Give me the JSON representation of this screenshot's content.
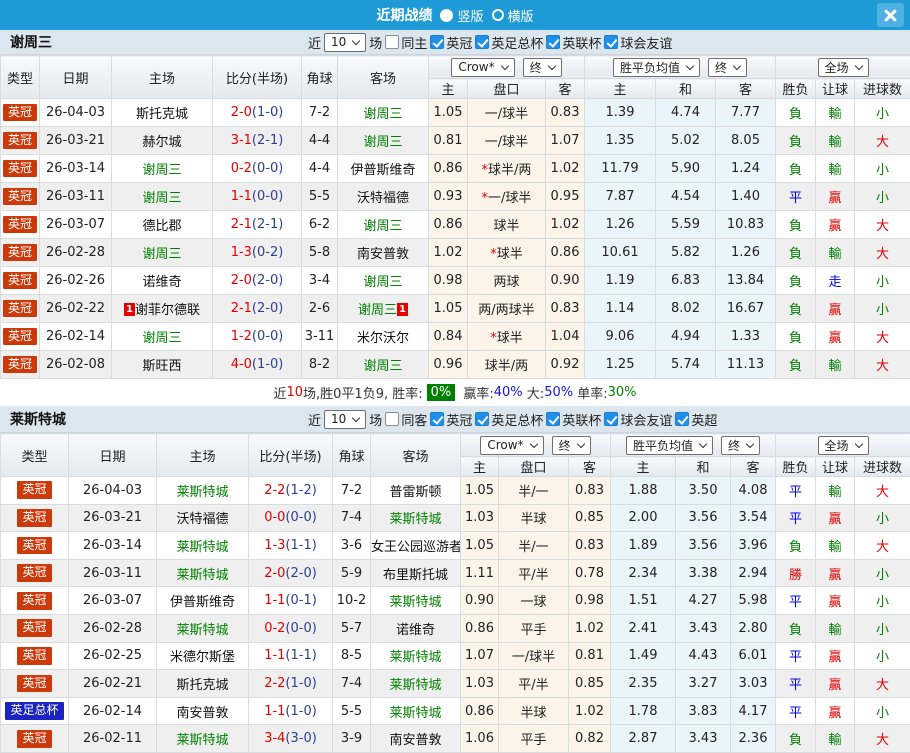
{
  "titlebar": {
    "title": "近期战绩",
    "layout_options": [
      {
        "label": "竖版",
        "selected": true
      },
      {
        "label": "横版",
        "selected": false
      }
    ]
  },
  "colors": {
    "titlebar": "#1e9ad7",
    "league_badge_red": "#cc3a0c",
    "facup_badge_blue": "#1b24c0",
    "win_red": "#e60000",
    "draw_blue": "#0000e0",
    "loss_green": "#008000",
    "self_team_green": "#008000"
  },
  "table_header": {
    "cols": {
      "type": "类型",
      "date": "日期",
      "home": "主场",
      "score": "比分(半场)",
      "corner": "角球",
      "away": "客场",
      "odds_home": "主",
      "handicap": "盘口",
      "odds_away": "客",
      "avg_home": "主",
      "avg_draw": "和",
      "avg_away": "客",
      "result": "胜负",
      "handicap_result": "让球",
      "goals": "进球数"
    },
    "selects": {
      "company": "Crow*",
      "company_time": "终",
      "avg": "胜平负均值",
      "avg_time": "终",
      "scope": "全场"
    }
  },
  "teams": [
    {
      "name": "谢周三",
      "filters": {
        "near_label": "近",
        "games_value": "10",
        "games_label": "场",
        "same_label": "同主",
        "same_checked": false,
        "leagues": [
          {
            "label": "英冠",
            "checked": true
          },
          {
            "label": "英足总杯",
            "checked": true
          },
          {
            "label": "英联杯",
            "checked": true
          },
          {
            "label": "球会友谊",
            "checked": true
          }
        ]
      },
      "rows": [
        {
          "league": "英冠",
          "date": "26-04-03",
          "home": "斯托克城",
          "score": "2-0",
          "half": "(1-0)",
          "corner": "7-2",
          "away": "谢周三",
          "odds": [
            "1.05",
            "一/球半",
            "0.83"
          ],
          "avg": [
            "1.39",
            "4.74",
            "7.77"
          ],
          "res": "負",
          "lb": "輸",
          "goal": "小"
        },
        {
          "league": "英冠",
          "date": "26-03-21",
          "home": "赫尔城",
          "score": "3-1",
          "half": "(2-1)",
          "corner": "4-4",
          "away": "谢周三",
          "odds": [
            "0.81",
            "一/球半",
            "1.07"
          ],
          "avg": [
            "1.35",
            "5.02",
            "8.05"
          ],
          "res": "負",
          "lb": "輸",
          "goal": "大"
        },
        {
          "league": "英冠",
          "date": "26-03-14",
          "home": "谢周三",
          "score": "0-2",
          "half": "(0-0)",
          "corner": "4-4",
          "away": "伊普斯维奇",
          "odds": [
            "0.86",
            "*球半/两",
            "1.02"
          ],
          "avg": [
            "11.79",
            "5.90",
            "1.24"
          ],
          "res": "負",
          "lb": "輸",
          "goal": "小"
        },
        {
          "league": "英冠",
          "date": "26-03-11",
          "home": "谢周三",
          "score": "1-1",
          "half": "(0-0)",
          "corner": "5-5",
          "away": "沃特福德",
          "odds": [
            "0.93",
            "*一/球半",
            "0.95"
          ],
          "avg": [
            "7.87",
            "4.54",
            "1.40"
          ],
          "res": "平",
          "lb": "贏",
          "goal": "小"
        },
        {
          "league": "英冠",
          "date": "26-03-07",
          "home": "德比郡",
          "score": "2-1",
          "half": "(2-1)",
          "corner": "6-2",
          "away": "谢周三",
          "odds": [
            "0.86",
            "球半",
            "1.02"
          ],
          "avg": [
            "1.26",
            "5.59",
            "10.83"
          ],
          "res": "負",
          "lb": "贏",
          "goal": "大"
        },
        {
          "league": "英冠",
          "date": "26-02-28",
          "home": "谢周三",
          "score": "1-3",
          "half": "(0-2)",
          "corner": "5-8",
          "away": "南安普敦",
          "odds": [
            "1.02",
            "*球半",
            "0.86"
          ],
          "avg": [
            "10.61",
            "5.82",
            "1.26"
          ],
          "res": "負",
          "lb": "輸",
          "goal": "大"
        },
        {
          "league": "英冠",
          "date": "26-02-26",
          "home": "诺维奇",
          "score": "2-0",
          "half": "(2-0)",
          "corner": "3-4",
          "away": "谢周三",
          "odds": [
            "0.98",
            "两球",
            "0.90"
          ],
          "avg": [
            "1.19",
            "6.83",
            "13.84"
          ],
          "res": "負",
          "lb": "走",
          "goal": "小"
        },
        {
          "league": "英冠",
          "date": "26-02-22",
          "home": "谢菲尔德联",
          "home_card": "1",
          "score": "2-1",
          "half": "(2-0)",
          "corner": "2-6",
          "away": "谢周三",
          "away_card": "1",
          "odds": [
            "1.05",
            "两/两球半",
            "0.83"
          ],
          "avg": [
            "1.14",
            "8.02",
            "16.67"
          ],
          "res": "負",
          "lb": "贏",
          "goal": "小"
        },
        {
          "league": "英冠",
          "date": "26-02-14",
          "home": "谢周三",
          "score": "1-2",
          "half": "(0-0)",
          "corner": "3-11",
          "away": "米尔沃尔",
          "odds": [
            "0.84",
            "*球半",
            "1.04"
          ],
          "avg": [
            "9.06",
            "4.94",
            "1.33"
          ],
          "res": "負",
          "lb": "贏",
          "goal": "大"
        },
        {
          "league": "英冠",
          "date": "26-02-08",
          "home": "斯旺西",
          "score": "4-0",
          "half": "(1-0)",
          "corner": "8-2",
          "away": "谢周三",
          "odds": [
            "0.96",
            "球半/两",
            "0.92"
          ],
          "avg": [
            "1.25",
            "5.74",
            "11.13"
          ],
          "res": "負",
          "lb": "輸",
          "goal": "大"
        }
      ],
      "summary": {
        "near": "近",
        "count": "10",
        "record": "场,胜0平1负9, 胜率:",
        "win_rate": "0%",
        "win_label": " 赢率:",
        "win_value": "40%",
        "big_label": " 大:",
        "big_value": "50%",
        "single_label": " 单率:",
        "single_value": "30%"
      }
    },
    {
      "name": "莱斯特城",
      "filters": {
        "near_label": "近",
        "games_value": "10",
        "games_label": "场",
        "same_label": "同客",
        "same_checked": false,
        "leagues": [
          {
            "label": "英冠",
            "checked": true
          },
          {
            "label": "英足总杯",
            "checked": true
          },
          {
            "label": "英联杯",
            "checked": true
          },
          {
            "label": "球会友谊",
            "checked": true
          },
          {
            "label": "英超",
            "checked": true
          }
        ]
      },
      "rows": [
        {
          "league": "英冠",
          "date": "26-04-03",
          "home": "莱斯特城",
          "score": "2-2",
          "half": "(1-2)",
          "corner": "7-2",
          "away": "普雷斯顿",
          "odds": [
            "1.05",
            "半/一",
            "0.83"
          ],
          "avg": [
            "1.88",
            "3.50",
            "4.08"
          ],
          "res": "平",
          "lb": "輸",
          "goal": "大"
        },
        {
          "league": "英冠",
          "date": "26-03-21",
          "home": "沃特福德",
          "score": "0-0",
          "half": "(0-0)",
          "corner": "7-4",
          "away": "莱斯特城",
          "odds": [
            "1.03",
            "半球",
            "0.85"
          ],
          "avg": [
            "2.00",
            "3.56",
            "3.54"
          ],
          "res": "平",
          "lb": "贏",
          "goal": "小"
        },
        {
          "league": "英冠",
          "date": "26-03-14",
          "home": "莱斯特城",
          "score": "1-3",
          "half": "(1-1)",
          "corner": "3-6",
          "away": "女王公园巡游者",
          "odds": [
            "1.05",
            "半/一",
            "0.83"
          ],
          "avg": [
            "1.89",
            "3.56",
            "3.96"
          ],
          "res": "負",
          "lb": "輸",
          "goal": "大"
        },
        {
          "league": "英冠",
          "date": "26-03-11",
          "home": "莱斯特城",
          "score": "2-0",
          "half": "(2-0)",
          "corner": "5-9",
          "away": "布里斯托城",
          "odds": [
            "1.11",
            "平/半",
            "0.78"
          ],
          "avg": [
            "2.34",
            "3.38",
            "2.94"
          ],
          "res": "勝",
          "lb": "贏",
          "goal": "小"
        },
        {
          "league": "英冠",
          "date": "26-03-07",
          "home": "伊普斯维奇",
          "score": "1-1",
          "half": "(0-1)",
          "corner": "10-2",
          "away": "莱斯特城",
          "odds": [
            "0.90",
            "一球",
            "0.98"
          ],
          "avg": [
            "1.51",
            "4.27",
            "5.98"
          ],
          "res": "平",
          "lb": "贏",
          "goal": "小"
        },
        {
          "league": "英冠",
          "date": "26-02-28",
          "home": "莱斯特城",
          "score": "0-2",
          "half": "(0-0)",
          "corner": "5-7",
          "away": "诺维奇",
          "odds": [
            "0.86",
            "平手",
            "1.02"
          ],
          "avg": [
            "2.41",
            "3.43",
            "2.80"
          ],
          "res": "負",
          "lb": "輸",
          "goal": "小"
        },
        {
          "league": "英冠",
          "date": "26-02-25",
          "home": "米德尔斯堡",
          "score": "1-1",
          "half": "(1-1)",
          "corner": "8-5",
          "away": "莱斯特城",
          "odds": [
            "1.07",
            "一/球半",
            "0.81"
          ],
          "avg": [
            "1.49",
            "4.43",
            "6.01"
          ],
          "res": "平",
          "lb": "贏",
          "goal": "小"
        },
        {
          "league": "英冠",
          "date": "26-02-21",
          "home": "斯托克城",
          "score": "2-2",
          "half": "(1-0)",
          "corner": "7-4",
          "away": "莱斯特城",
          "odds": [
            "1.03",
            "平/半",
            "0.85"
          ],
          "avg": [
            "2.35",
            "3.27",
            "3.03"
          ],
          "res": "平",
          "lb": "贏",
          "goal": "大"
        },
        {
          "league": "英足总杯",
          "date": "26-02-14",
          "home": "南安普敦",
          "score": "1-1",
          "half": "(1-0)",
          "corner": "5-5",
          "away": "莱斯特城",
          "odds": [
            "0.86",
            "半球",
            "1.02"
          ],
          "avg": [
            "1.78",
            "3.83",
            "4.17"
          ],
          "res": "平",
          "lb": "贏",
          "goal": "小"
        },
        {
          "league": "英冠",
          "date": "26-02-11",
          "home": "莱斯特城",
          "score": "3-4",
          "half": "(3-0)",
          "corner": "3-9",
          "away": "南安普敦",
          "odds": [
            "1.06",
            "平手",
            "0.82"
          ],
          "avg": [
            "2.87",
            "3.43",
            "2.36"
          ],
          "res": "負",
          "lb": "輸",
          "goal": "大"
        }
      ]
    }
  ]
}
